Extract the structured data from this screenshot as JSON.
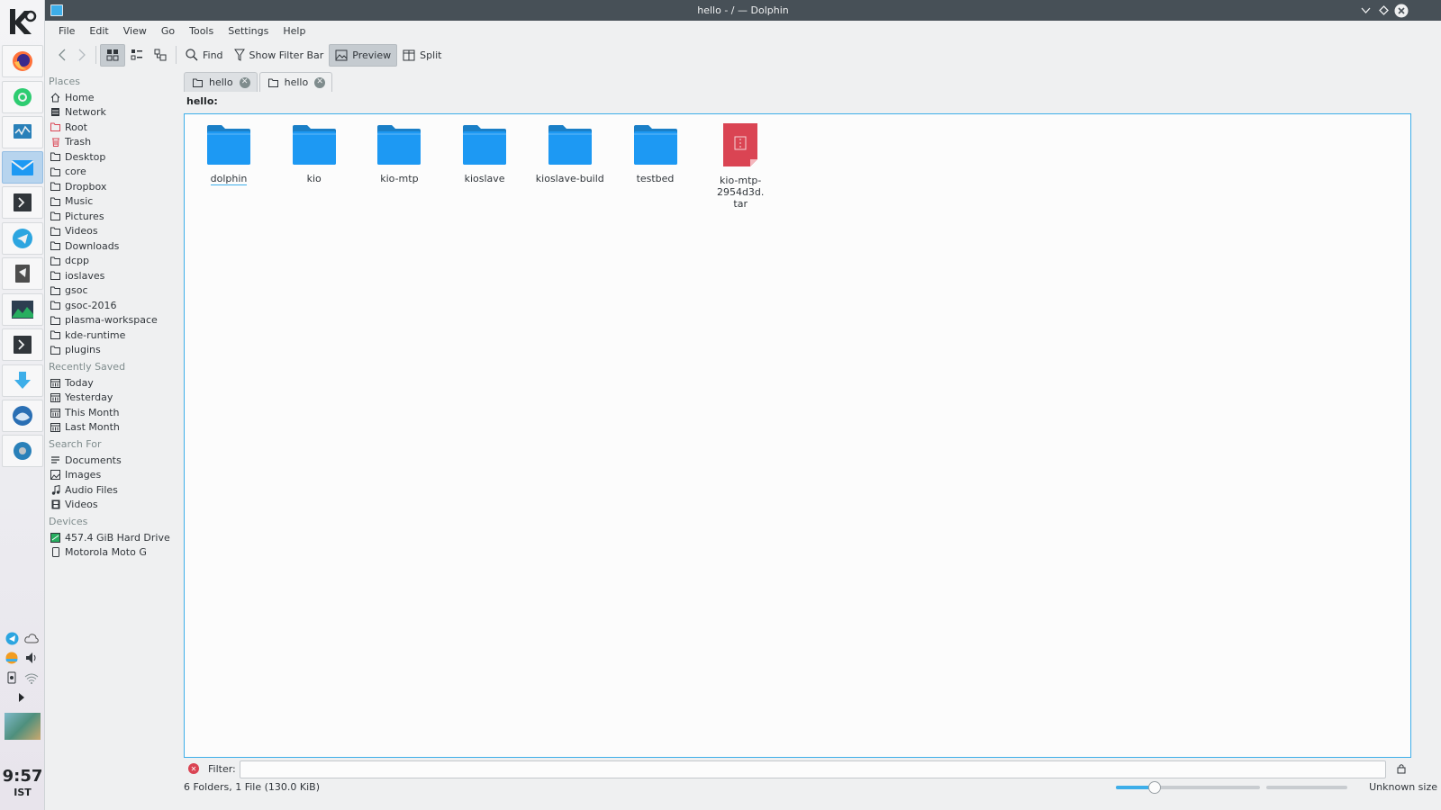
{
  "window": {
    "title": "hello - / — Dolphin"
  },
  "menubar": {
    "items": [
      "File",
      "Edit",
      "View",
      "Go",
      "Tools",
      "Settings",
      "Help"
    ]
  },
  "toolbar": {
    "find_label": "Find",
    "filter_label": "Show Filter Bar",
    "preview_label": "Preview",
    "split_label": "Split"
  },
  "sidebar": {
    "places_header": "Places",
    "places": [
      {
        "label": "Home",
        "icon": "home-icon"
      },
      {
        "label": "Network",
        "icon": "network-icon"
      },
      {
        "label": "Root",
        "icon": "root-folder-icon"
      },
      {
        "label": "Trash",
        "icon": "trash-icon"
      },
      {
        "label": "Desktop",
        "icon": "folder-icon"
      },
      {
        "label": "core",
        "icon": "folder-icon"
      },
      {
        "label": "Dropbox",
        "icon": "folder-icon"
      },
      {
        "label": "Music",
        "icon": "folder-icon"
      },
      {
        "label": "Pictures",
        "icon": "folder-icon"
      },
      {
        "label": "Videos",
        "icon": "folder-icon"
      },
      {
        "label": "Downloads",
        "icon": "folder-icon"
      },
      {
        "label": "dcpp",
        "icon": "folder-icon"
      },
      {
        "label": "ioslaves",
        "icon": "folder-icon"
      },
      {
        "label": "gsoc",
        "icon": "folder-icon"
      },
      {
        "label": "gsoc-2016",
        "icon": "folder-icon"
      },
      {
        "label": "plasma-workspace",
        "icon": "folder-icon"
      },
      {
        "label": "kde-runtime",
        "icon": "folder-icon"
      },
      {
        "label": "plugins",
        "icon": "folder-icon"
      }
    ],
    "recent_header": "Recently Saved",
    "recent": [
      {
        "label": "Today",
        "icon": "calendar-icon"
      },
      {
        "label": "Yesterday",
        "icon": "calendar-icon"
      },
      {
        "label": "This Month",
        "icon": "calendar-icon"
      },
      {
        "label": "Last Month",
        "icon": "calendar-icon"
      }
    ],
    "search_header": "Search For",
    "search": [
      {
        "label": "Documents",
        "icon": "document-icon"
      },
      {
        "label": "Images",
        "icon": "image-icon"
      },
      {
        "label": "Audio Files",
        "icon": "music-note-icon"
      },
      {
        "label": "Videos",
        "icon": "film-icon"
      }
    ],
    "devices_header": "Devices",
    "devices": [
      {
        "label": "457.4 GiB Hard Drive",
        "icon": "hard-drive-icon"
      },
      {
        "label": "Motorola Moto G",
        "icon": "phone-icon"
      }
    ]
  },
  "tabs": [
    {
      "label": "hello",
      "active": false
    },
    {
      "label": "hello",
      "active": true
    }
  ],
  "location": "hello:",
  "files": [
    {
      "name": "dolphin",
      "type": "folder"
    },
    {
      "name": "kio",
      "type": "folder"
    },
    {
      "name": "kio-mtp",
      "type": "folder"
    },
    {
      "name": "kioslave",
      "type": "folder"
    },
    {
      "name": "kioslave-build",
      "type": "folder"
    },
    {
      "name": "testbed",
      "type": "folder"
    },
    {
      "name": "kio-mtp-2954d3d.\ntar",
      "type": "archive"
    }
  ],
  "filterbar": {
    "label": "Filter:",
    "value": ""
  },
  "statusbar": {
    "summary": "6 Folders, 1 File (130.0 KiB)",
    "zoom_fraction": 0.27,
    "space_label": "Unknown size"
  },
  "clock": {
    "time": "9:57",
    "zone": "IST"
  },
  "colors": {
    "accent": "#3daee9",
    "folder": "#1d99f3",
    "archive": "#da4453"
  }
}
